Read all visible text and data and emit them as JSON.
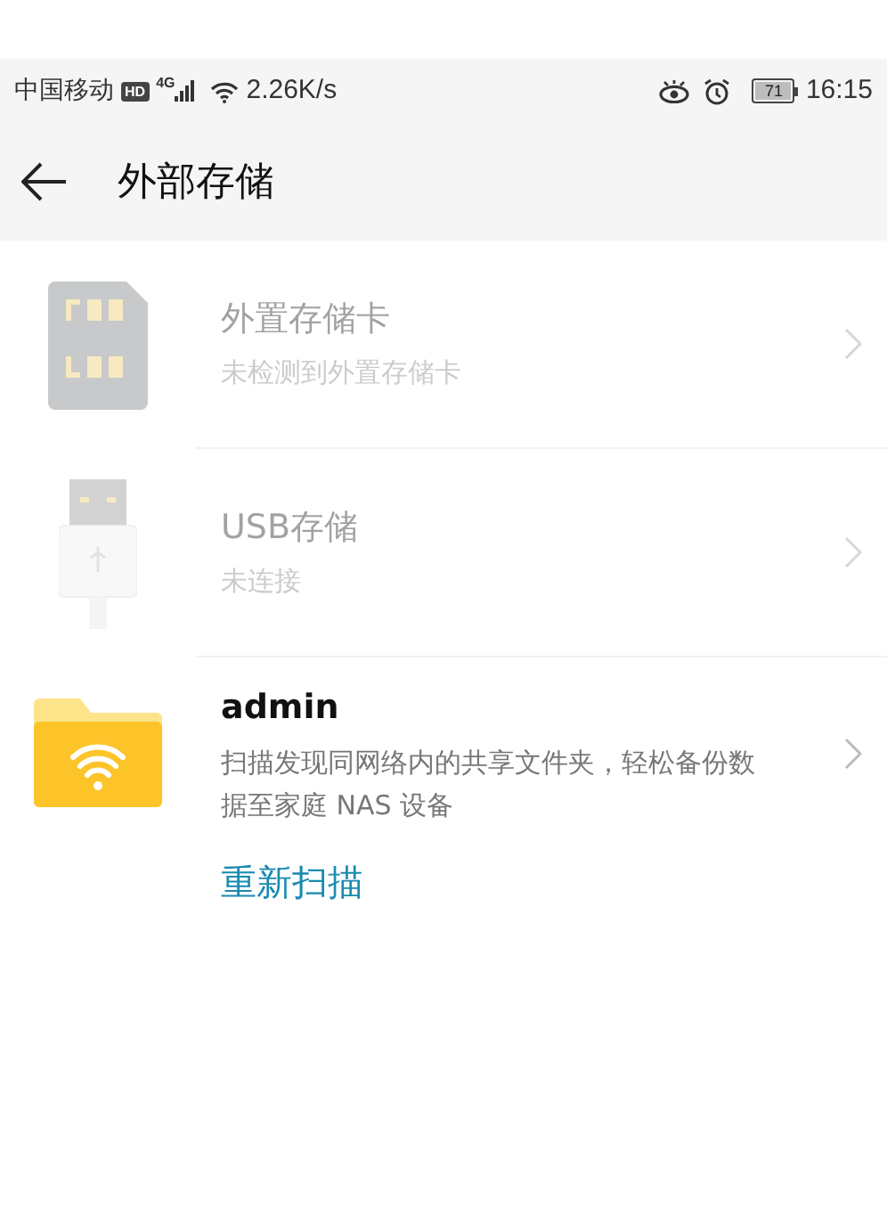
{
  "status_bar": {
    "carrier": "中国移动",
    "hd": "HD",
    "network": "4G",
    "speed": "2.26K/s",
    "battery": "71",
    "time": "16:15"
  },
  "header": {
    "title": "外部存储"
  },
  "items": [
    {
      "kind": "sd-card",
      "title": "外置存储卡",
      "subtitle": "未检测到外置存储卡",
      "disabled": true
    },
    {
      "kind": "usb",
      "title": "USB存储",
      "subtitle": "未连接",
      "disabled": true
    },
    {
      "kind": "network-folder",
      "title": "admin",
      "subtitle": "扫描发现同网络内的共享文件夹，轻松备份数据至家庭 NAS 设备",
      "disabled": false
    }
  ],
  "rescan_link": "重新扫描"
}
